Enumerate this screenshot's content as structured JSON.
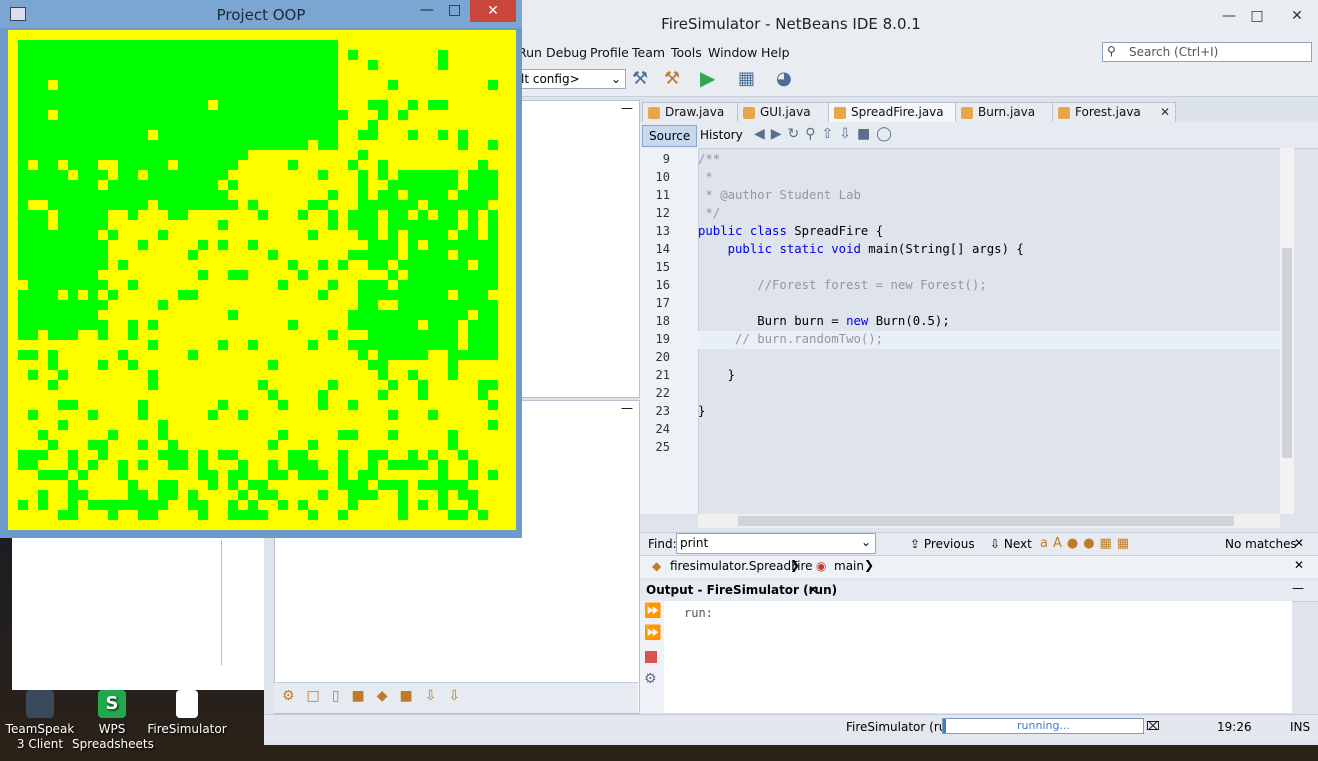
{
  "desktop": {
    "icons": [
      {
        "label": "TeamSpeak 3 Client",
        "icon": "teamspeak-icon"
      },
      {
        "label": "WPS Spreadsheets",
        "icon": "wps-spreadsheets-icon"
      },
      {
        "label": "FireSimulator",
        "icon": "file-icon"
      }
    ]
  },
  "netbeans": {
    "title": "FireSimulator - NetBeans IDE 8.0.1",
    "menu": [
      "Run",
      "Debug",
      "Profile",
      "Team",
      "Tools",
      "Window",
      "Help"
    ],
    "search_placeholder": "Search (Ctrl+I)",
    "config_select": "lt config>",
    "tabs": [
      {
        "label": "Draw.java"
      },
      {
        "label": "GUI.java"
      },
      {
        "label": "SpreadFire.java",
        "active": true
      },
      {
        "label": "Burn.java"
      },
      {
        "label": "Forest.java"
      }
    ],
    "source_tab": "Source",
    "history_tab": "History",
    "lines": [
      {
        "n": "9",
        "text": "/**"
      },
      {
        "n": "10",
        "text": " *"
      },
      {
        "n": "11",
        "text": " * @author Student Lab"
      },
      {
        "n": "12",
        "text": " */"
      },
      {
        "n": "13",
        "text": "public class SpreadFire {"
      },
      {
        "n": "14",
        "text": "    public static void main(String[] args) {"
      },
      {
        "n": "15",
        "text": ""
      },
      {
        "n": "16",
        "text": "        //Forest forest = new Forest();"
      },
      {
        "n": "17",
        "text": ""
      },
      {
        "n": "18",
        "text": "        Burn burn = new Burn(0.5);"
      },
      {
        "n": "19",
        "text": "     // burn.randomTwo();"
      },
      {
        "n": "20",
        "text": ""
      },
      {
        "n": "21",
        "text": "    }"
      },
      {
        "n": "22",
        "text": ""
      },
      {
        "n": "23",
        "text": "}"
      },
      {
        "n": "24",
        "text": ""
      },
      {
        "n": "25",
        "text": ""
      }
    ],
    "find": {
      "label": "Find:",
      "value": "print",
      "previous": "Previous",
      "next": "Next",
      "status": "No matches"
    },
    "breadcrumbs": [
      "firesimulator.SpreadFire",
      "main"
    ],
    "output": {
      "title": "Output - FireSimulator (run)",
      "text": "run:"
    },
    "status": {
      "task": "FireSimulator (run)",
      "progress": "running...",
      "time": "19:26",
      "mode": "INS"
    }
  },
  "oop_window": {
    "title": "Project OOP",
    "colors": {
      "tree": "#00ff00",
      "empty": "#ffff00"
    }
  }
}
